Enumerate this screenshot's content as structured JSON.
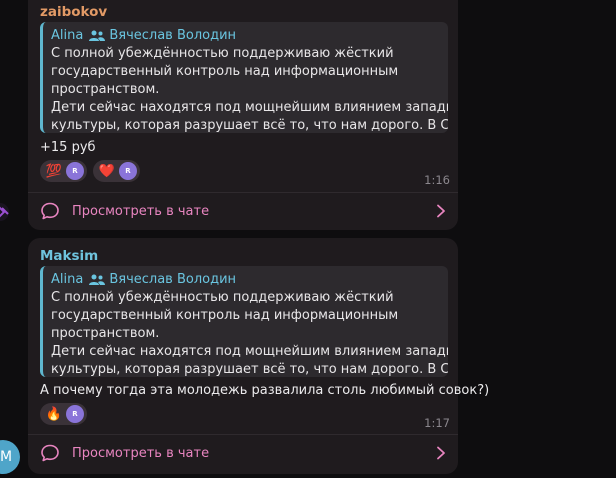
{
  "messages": [
    {
      "author": "zaibokov",
      "reply": {
        "sender": "Alina",
        "chat": "Вячеслав Володин",
        "lines": [
          "С полной убеждённостью поддерживаю жёсткий",
          "государственный контроль над информационным",
          "пространством.",
          "Дети сейчас находятся под мощнейшим влиянием западной",
          "культуры, которая разрушает всё то, что нам дорого. В Сове..."
        ]
      },
      "text": "+15 руб",
      "reactions": [
        {
          "emoji": "💯",
          "avatar": "R"
        },
        {
          "emoji": "❤️",
          "avatar": "R"
        }
      ],
      "time": "1:16",
      "view_label": "Просмотреть в чате"
    },
    {
      "author": "Maksim",
      "reply": {
        "sender": "Alina",
        "chat": "Вячеслав Володин",
        "lines": [
          "С полной убеждённостью поддерживаю жёсткий",
          "государственный контроль над информационным",
          "пространством.",
          "Дети сейчас находятся под мощнейшим влиянием западной",
          "культуры, которая разрушает всё то, что нам дорого. В Сове..."
        ]
      },
      "text": "А почему тогда эта молодежь развалила столь любимый совок?)",
      "reactions": [
        {
          "emoji": "🔥",
          "avatar": "R"
        }
      ],
      "time": "1:17",
      "view_label": "Просмотреть в чате"
    }
  ],
  "side_avatar_letter": "M",
  "colors": {
    "background": "#0e0d0f",
    "bubble": "#1f1b1e",
    "author1": "#e29a66",
    "author2": "#6fc3dd",
    "reply_accent": "#5fb7cf",
    "link": "#e885c0"
  },
  "icons": [
    "users-icon",
    "message-bubble-icon",
    "chevron-right-icon",
    "reaction-avatar",
    "user-avatar"
  ]
}
